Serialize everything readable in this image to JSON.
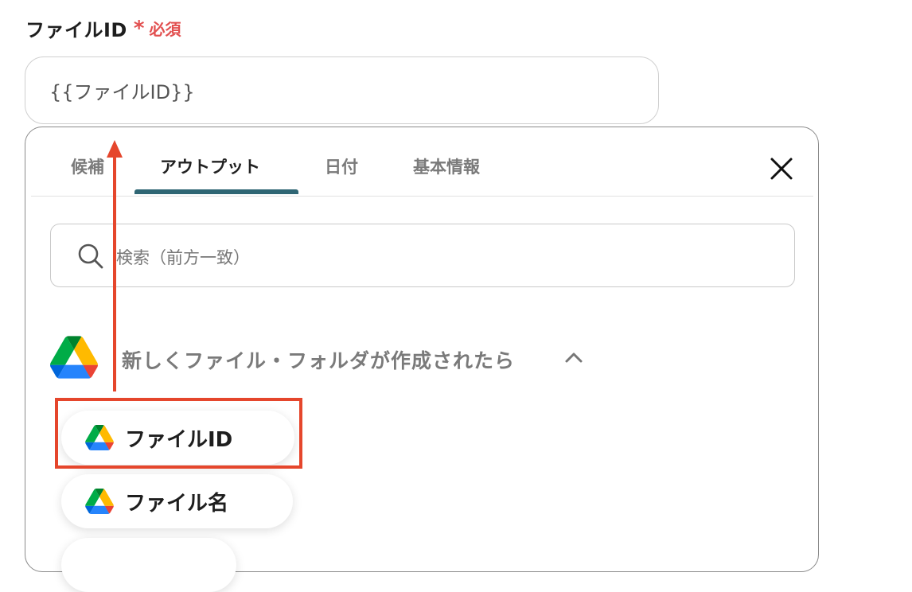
{
  "field": {
    "label": "ファイルID",
    "required_star": "*",
    "required_text": "必須",
    "value": "{{ファイルID}}"
  },
  "panel": {
    "tabs": [
      {
        "label": "候補",
        "active": false
      },
      {
        "label": "アウトプット",
        "active": true
      },
      {
        "label": "日付",
        "active": false
      },
      {
        "label": "基本情報",
        "active": false
      }
    ],
    "search": {
      "placeholder": "検索（前方一致）"
    },
    "group": {
      "title": "新しくファイル・フォルダが作成されたら",
      "expanded": true,
      "icon": "google-drive-icon"
    },
    "items": [
      {
        "label": "ファイルID",
        "icon": "google-drive-icon",
        "highlighted": true
      },
      {
        "label": "ファイル名",
        "icon": "google-drive-icon",
        "highlighted": false
      }
    ]
  },
  "colors": {
    "accent_tab": "#2f6674",
    "required": "#e25050",
    "annotation": "#e5462c"
  }
}
